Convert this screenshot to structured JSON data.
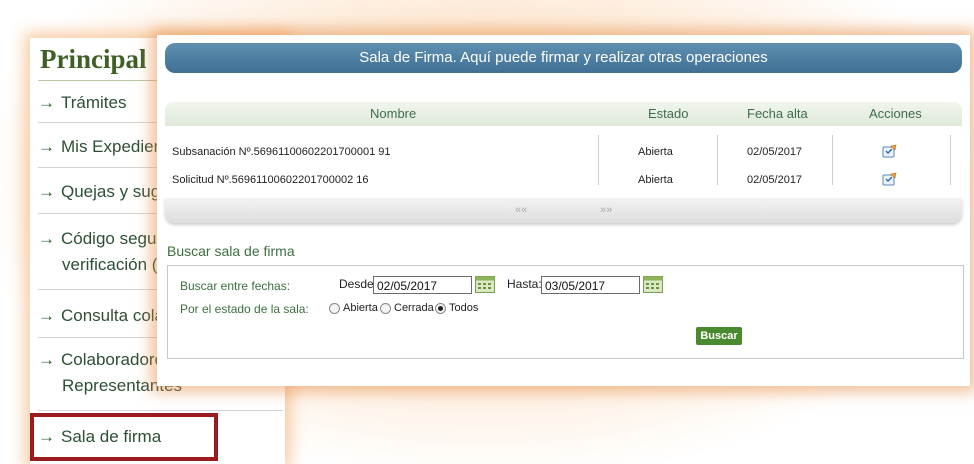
{
  "nav": {
    "title": "Principal",
    "items": [
      {
        "arrow": "→",
        "label": "Trámites",
        "cont": ""
      },
      {
        "arrow": "→",
        "label": "Mis Expedien",
        "cont": ""
      },
      {
        "arrow": "→",
        "label": "Quejas y sug",
        "cont": ""
      },
      {
        "arrow": "→",
        "label": "Código segur",
        "cont": "verificación ("
      },
      {
        "arrow": "→",
        "label": "Consulta cola",
        "cont": ""
      },
      {
        "arrow": "→",
        "label": "Colaboradore",
        "cont": "Representantes"
      },
      {
        "arrow": "→",
        "label": "Sala de firma",
        "cont": ""
      }
    ]
  },
  "dialog": {
    "header": "Sala de Firma. Aquí puede firmar y realizar otras operaciones",
    "columns": [
      "Nombre",
      "Estado",
      "Fecha alta",
      "Acciones"
    ],
    "rows": [
      {
        "nombre": "Subsanación Nº.56961100602201700001 91",
        "estado": "Abierta",
        "fecha": "02/05/2017",
        "accion": "edit-icon"
      },
      {
        "nombre": "Solicitud Nº.56961100602201700002 16",
        "estado": "Abierta",
        "fecha": "02/05/2017",
        "accion": "edit-icon"
      }
    ],
    "pager": {
      "prev": "««",
      "next": "»»"
    }
  },
  "search": {
    "title": "Buscar sala de firma",
    "dates_label": "Buscar entre fechas:",
    "desde_label": "Desde:",
    "desde_value": "02/05/2017",
    "hasta_label": "Hasta:",
    "hasta_value": "03/05/2017",
    "state_label": "Por el estado de la sala:",
    "options": [
      "Abierta",
      "Cerrada",
      "Todos"
    ],
    "selected": "Todos",
    "button": "Buscar"
  },
  "colors": {
    "header": "#4a7a9e",
    "accent": "#3b6f3f",
    "highlight": "#9b1b1e",
    "button": "#4a8a2f"
  }
}
